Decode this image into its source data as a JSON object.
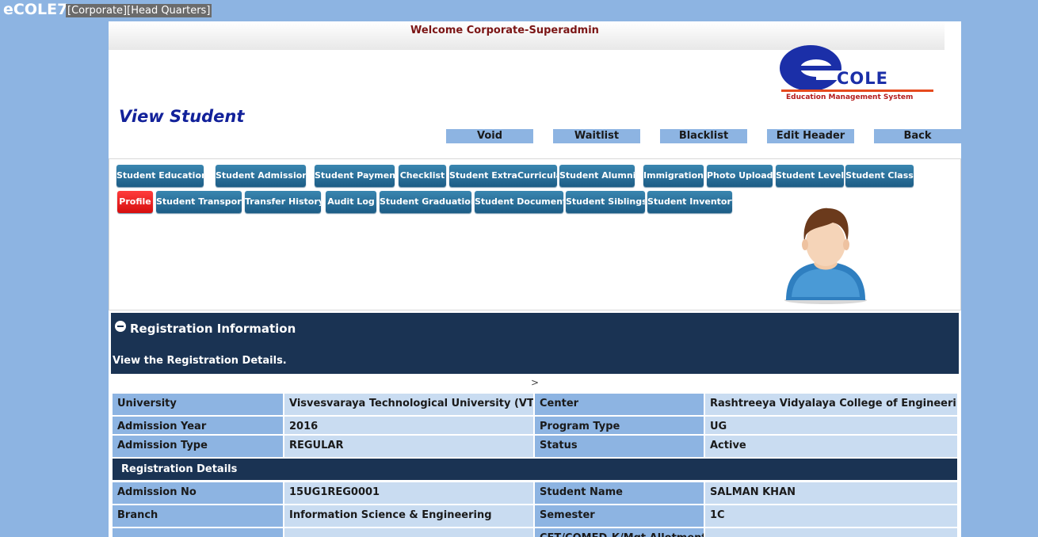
{
  "app": {
    "name": "eCOLE7",
    "org": "[Corporate][Head Quarters]"
  },
  "welcome": "Welcome Corporate-Superadmin",
  "logo": {
    "word": "COLE",
    "subtitle": "Education Management System"
  },
  "page_title": "View Student",
  "header_buttons": [
    "Void",
    "Waitlist",
    "Blacklist",
    "Edit Header",
    "Back"
  ],
  "tabs_row1": [
    "Student Education",
    "Student Admission",
    "Student Payment",
    "Checklist",
    "Student ExtraCurricular",
    "Student Alumni",
    "Immigration",
    "Photo Upload",
    "Student Level",
    "Student Class"
  ],
  "tabs_row2": [
    "Profile",
    "Student Transport",
    "Transfer History",
    "Audit Log",
    "Student Graduation",
    "Student Document",
    "Student Siblings",
    "Student Inventory"
  ],
  "active_tab": "Profile",
  "registration": {
    "title": "Registration Information",
    "subtitle": "View the Registration Details.",
    "arrow": ">",
    "section_label": "Registration Details",
    "rows": [
      [
        {
          "label": "University",
          "value": "Visvesvaraya Technological University (VTU)"
        },
        {
          "label": "Center",
          "value": "Rashtreeya Vidyalaya College of Engineering"
        }
      ],
      [
        {
          "label": "Admission Year",
          "value": "2016"
        },
        {
          "label": "Program Type",
          "value": "UG"
        }
      ],
      [
        {
          "label": "Admission Type",
          "value": "REGULAR"
        },
        {
          "label": "Status",
          "value": "Active"
        }
      ]
    ],
    "rows2": [
      [
        {
          "label": "Admission No",
          "value": "15UG1REG0001"
        },
        {
          "label": "Student Name",
          "value": "SALMAN KHAN"
        }
      ],
      [
        {
          "label": "Branch",
          "value": "Information Science & Engineering"
        },
        {
          "label": "Semester",
          "value": "1C"
        }
      ],
      [
        {
          "label": "",
          "value": ""
        },
        {
          "label": "CET/COMED-K/Mgt Allotment",
          "value": ""
        }
      ]
    ]
  },
  "colors": {
    "page_bg": "#8db4e2",
    "dark_header": "#1a3353",
    "tab_blue": "#1d5d86",
    "tab_active": "#d60e0e",
    "title_blue": "#12219a"
  }
}
